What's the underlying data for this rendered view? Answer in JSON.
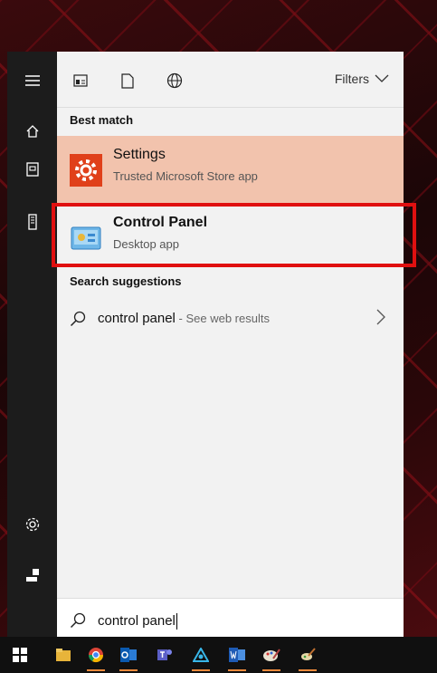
{
  "search_panel": {
    "filters_label": "Filters",
    "best_match_label": "Best match",
    "results": [
      {
        "title": "Settings",
        "subtitle": "Trusted Microsoft Store app",
        "icon": "settings-gear-icon",
        "selected": true
      },
      {
        "title": "Control Panel",
        "subtitle": "Desktop app",
        "icon": "control-panel-icon",
        "selected": false
      }
    ],
    "suggestions_label": "Search suggestions",
    "suggestion": {
      "query": "control panel",
      "hint": " - See web results"
    }
  },
  "search": {
    "value": "control panel"
  },
  "rail_icons": [
    "hamburger-menu-icon",
    "home-icon",
    "documents-icon",
    "tower-icon",
    "settings-icon",
    "user-icon"
  ],
  "topbar_icons": [
    "apps-icon",
    "document-icon",
    "web-icon"
  ],
  "taskbar_icons": [
    "windows-start-icon",
    "file-explorer-icon",
    "chrome-icon",
    "outlook-icon",
    "teams-icon",
    "app-icon",
    "word-icon",
    "paint-icon",
    "tool-icon"
  ],
  "colors": {
    "accent": "#f2c3ad",
    "highlight": "#e01010",
    "settings_icon": "#e0401a",
    "taskbar": "#101010",
    "rail": "#1c1c1c"
  }
}
